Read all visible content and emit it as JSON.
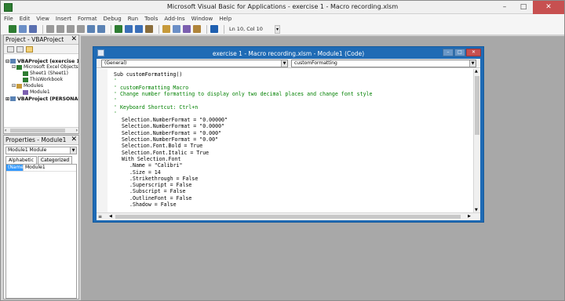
{
  "app": {
    "title": "Microsoft Visual Basic for Applications - exercise 1 - Macro recording.xlsm",
    "controls": {
      "minimize": "–",
      "maximize": "□",
      "close": "✕"
    }
  },
  "menu": [
    "File",
    "Edit",
    "View",
    "Insert",
    "Format",
    "Debug",
    "Run",
    "Tools",
    "Add-Ins",
    "Window",
    "Help"
  ],
  "toolbar": {
    "icons": [
      "excel-icon",
      "insert-module-icon",
      "save-icon",
      "cut-icon",
      "copy-icon",
      "paste-icon",
      "find-icon",
      "undo-icon",
      "redo-icon",
      "run-icon",
      "break-icon",
      "reset-icon",
      "design-mode-icon",
      "project-explorer-icon",
      "properties-icon",
      "object-browser-icon",
      "toolbox-icon",
      "help-icon"
    ],
    "status": "Ln 10, Col 10"
  },
  "project_pane": {
    "title": "Project - VBAProject",
    "close": "✕",
    "tree": [
      {
        "label": "VBAProject (exercise 1",
        "bold": true,
        "expander": "⊟"
      },
      {
        "label": "Microsoft Excel Objects",
        "bold": false,
        "expander": "⊟"
      },
      {
        "label": "Sheet1 (Sheet1)",
        "bold": false,
        "expander": ""
      },
      {
        "label": "ThisWorkbook",
        "bold": false,
        "expander": ""
      },
      {
        "label": "Modules",
        "bold": false,
        "expander": "⊟"
      },
      {
        "label": "Module1",
        "bold": false,
        "expander": ""
      },
      {
        "label": "VBAProject (PERSONAL.",
        "bold": true,
        "expander": "⊞"
      }
    ]
  },
  "properties_pane": {
    "title": "Properties - Module1",
    "close": "✕",
    "object": "Module1 Module",
    "tabs": [
      "Alphabetic",
      "Categorized"
    ],
    "rows": [
      {
        "key": "(Name)",
        "value": "Module1"
      }
    ]
  },
  "code_window": {
    "title": "exercise 1 - Macro recording.xlsm - Module1 (Code)",
    "object_combo": "(General)",
    "procedure_combo": "customFormatting",
    "lines": [
      {
        "t": "tx",
        "text": "Sub customFormatting()",
        "indent": 0
      },
      {
        "t": "cm",
        "text": "'",
        "indent": 0
      },
      {
        "t": "cm",
        "text": "' customFormatting Macro",
        "indent": 0
      },
      {
        "t": "cm",
        "text": "' Change number formatting to display only two decimal places and change font style",
        "indent": 0
      },
      {
        "t": "cm",
        "text": "'",
        "indent": 0
      },
      {
        "t": "cm",
        "text": "' Keyboard Shortcut: Ctrl+n",
        "indent": 0
      },
      {
        "t": "cm",
        "text": "'",
        "indent": 0
      },
      {
        "t": "tx",
        "text": "Selection.NumberFormat = \"0.00000\"",
        "indent": 1
      },
      {
        "t": "tx",
        "text": "Selection.NumberFormat = \"0.0000\"",
        "indent": 1
      },
      {
        "t": "tx",
        "text": "Selection.NumberFormat = \"0.000\"",
        "indent": 1
      },
      {
        "t": "tx",
        "text": "Selection.NumberFormat = \"0.00\"",
        "indent": 1
      },
      {
        "t": "tx",
        "text": "Selection.Font.Bold = True",
        "indent": 1
      },
      {
        "t": "tx",
        "text": "Selection.Font.Italic = True",
        "indent": 1
      },
      {
        "t": "tx",
        "text": "With Selection.Font",
        "indent": 1
      },
      {
        "t": "tx",
        "text": ".Name = \"Calibri\"",
        "indent": 2
      },
      {
        "t": "tx",
        "text": ".Size = 14",
        "indent": 2
      },
      {
        "t": "tx",
        "text": ".Strikethrough = False",
        "indent": 2
      },
      {
        "t": "tx",
        "text": ".Superscript = False",
        "indent": 2
      },
      {
        "t": "tx",
        "text": ".Subscript = False",
        "indent": 2
      },
      {
        "t": "tx",
        "text": ".OutlineFont = False",
        "indent": 2
      },
      {
        "t": "tx",
        "text": ".Shadow = False",
        "indent": 2
      }
    ]
  }
}
